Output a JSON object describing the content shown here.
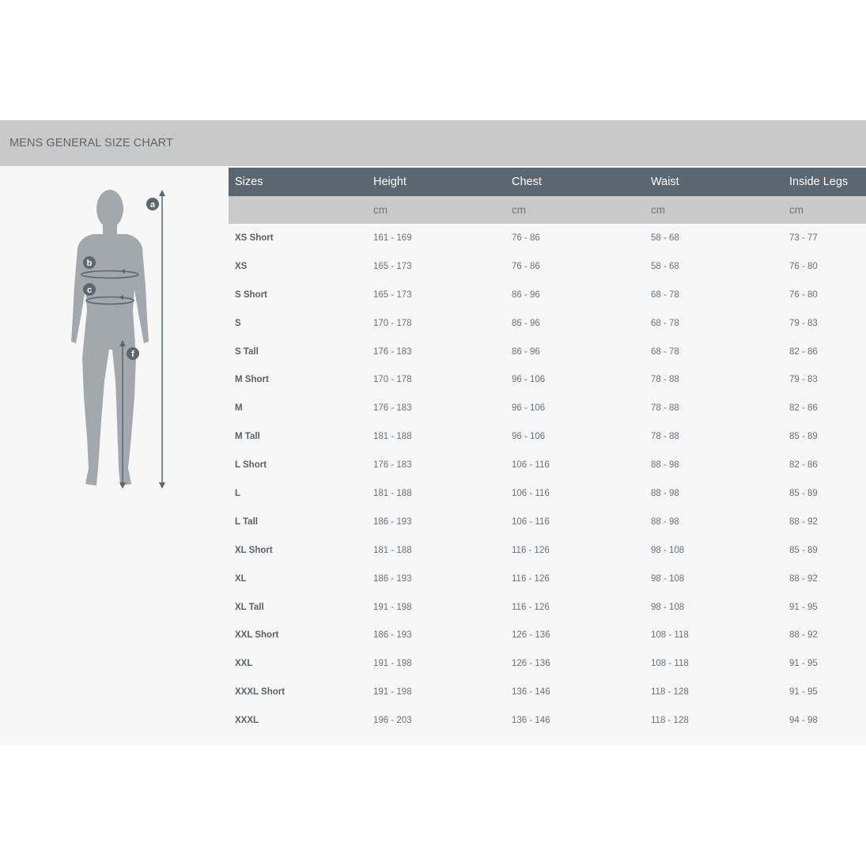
{
  "title": "MENS GENERAL SIZE CHART",
  "figure": {
    "markers": [
      "a",
      "b",
      "c",
      "f"
    ]
  },
  "table": {
    "headers": [
      "Sizes",
      "Height",
      "Chest",
      "Waist",
      "Inside Legs"
    ],
    "units": [
      "",
      "cm",
      "cm",
      "cm",
      "cm"
    ],
    "rows": [
      [
        "XS Short",
        "161 - 169",
        "76 - 86",
        "58 - 68",
        "73 - 77"
      ],
      [
        "XS",
        "165 - 173",
        "76 - 86",
        "58 - 68",
        "76 - 80"
      ],
      [
        "S Short",
        "165 - 173",
        "86 - 96",
        "68 - 78",
        "76 - 80"
      ],
      [
        "S",
        "170 - 178",
        "86 - 96",
        "68 - 78",
        "79 - 83"
      ],
      [
        "S Tall",
        "176 - 183",
        "86 - 96",
        "68 - 78",
        "82 - 86"
      ],
      [
        "M Short",
        "170 - 178",
        "96 - 106",
        "78 - 88",
        "79 - 83"
      ],
      [
        "M",
        "176 - 183",
        "96 - 106",
        "78 - 88",
        "82 - 86"
      ],
      [
        "M Tall",
        "181 - 188",
        "96 - 106",
        "78 - 88",
        "85 - 89"
      ],
      [
        "L Short",
        "176 - 183",
        "106 - 116",
        "88 - 98",
        "82 - 86"
      ],
      [
        "L",
        "181 - 188",
        "106 - 116",
        "88 - 98",
        "85 - 89"
      ],
      [
        "L Tall",
        "186 - 193",
        "106 - 116",
        "88 - 98",
        "88 - 92"
      ],
      [
        "XL Short",
        "181 - 188",
        "116 - 126",
        "98 - 108",
        "85 - 89"
      ],
      [
        "XL",
        "186 - 193",
        "116 - 126",
        "98 - 108",
        "88 - 92"
      ],
      [
        "XL Tall",
        "191 - 198",
        "116 - 126",
        "98 - 108",
        "91 - 95"
      ],
      [
        "XXL Short",
        "186 - 193",
        "126 - 136",
        "108 - 118",
        "88 - 92"
      ],
      [
        "XXL",
        "191 - 198",
        "126 - 136",
        "108 - 118",
        "91 - 95"
      ],
      [
        "XXXL Short",
        "191 - 198",
        "136 - 146",
        "118 - 128",
        "91 - 95"
      ],
      [
        "XXXL",
        "196 - 203",
        "136 - 146",
        "118 - 128",
        "94 - 98"
      ]
    ]
  }
}
